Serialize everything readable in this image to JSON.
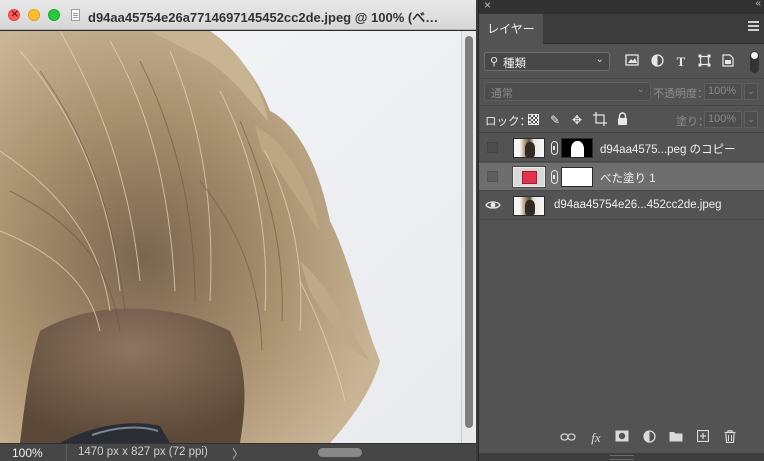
{
  "document": {
    "title": "d94aa45754e26a7714697145452cc2de.jpeg @ 100% (べ…",
    "zoom": "100%",
    "doc_info": "1470 px x 827 px (72 ppi)",
    "status_arrow": "〉"
  },
  "panel": {
    "close_glyph": "×",
    "collapse_glyph": "«",
    "tab_label": "レイヤー",
    "filter": {
      "search_glyph": "⚲",
      "kind_label": "種類",
      "chevron": "⌄"
    },
    "blend_mode": "通常",
    "opacity_label": "不透明度：",
    "opacity_value": "100%",
    "lock_label": "ロック：",
    "fill_label": "塗り：",
    "fill_value": "100%",
    "dropdown_glyph": "⌄"
  },
  "layers": [
    {
      "name": "d94aa4575...peg のコピー",
      "visible": false,
      "selected": false
    },
    {
      "name": "べた塗り 1",
      "visible": false,
      "selected": true
    },
    {
      "name": "d94aa45754e26...452cc2de.jpeg",
      "visible": true,
      "selected": false
    }
  ],
  "colors": {
    "fill_swatch": "#e0344f",
    "panel_bg": "#535353",
    "selected_row": "#6e6e6e"
  },
  "icons": {
    "filter": [
      "image-filter-icon",
      "adjustment-filter-icon",
      "type-filter-icon",
      "shape-filter-icon",
      "smart-object-filter-icon"
    ],
    "lock": [
      "lock-transparent-pixels-icon",
      "lock-image-pixels-icon",
      "lock-position-icon",
      "lock-artboard-icon",
      "lock-all-icon"
    ],
    "footer": [
      "link-layers-icon",
      "fx-icon",
      "add-mask-icon",
      "adjustment-layer-icon",
      "group-folder-icon",
      "new-layer-icon",
      "trash-icon"
    ]
  },
  "glyphs": {
    "type_filter": "T",
    "fx": "fx",
    "new_layer": "+",
    "lock_move": "✥",
    "lock_brush": "✎"
  }
}
